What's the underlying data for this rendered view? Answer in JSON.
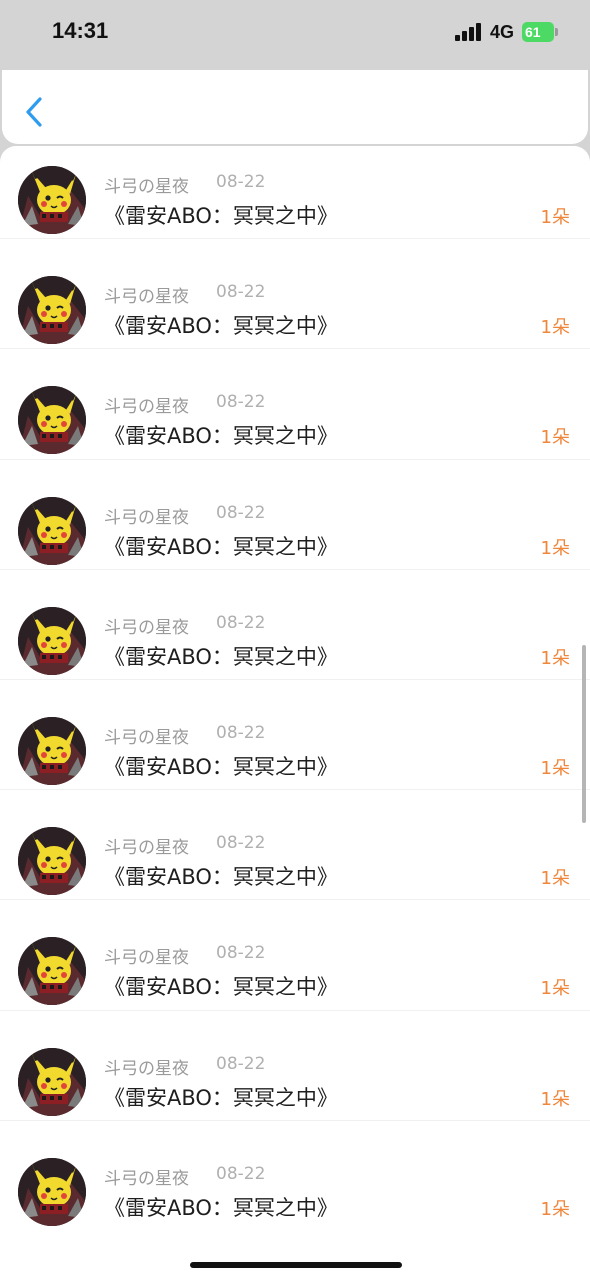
{
  "status_bar": {
    "time": "14:31",
    "network": "4G",
    "battery_level": "61",
    "signal_icon": "cellular-signal-icon",
    "battery_icon": "battery-charging-icon"
  },
  "nav": {
    "back_icon": "chevron-left-icon",
    "accent_color": "#2f9cf0"
  },
  "items": [
    {
      "author": "斗弓の星夜",
      "date": "08-22",
      "title": "《雷安ABO：冥冥之中》",
      "count": "1朵"
    },
    {
      "author": "斗弓の星夜",
      "date": "08-22",
      "title": "《雷安ABO：冥冥之中》",
      "count": "1朵"
    },
    {
      "author": "斗弓の星夜",
      "date": "08-22",
      "title": "《雷安ABO：冥冥之中》",
      "count": "1朵"
    },
    {
      "author": "斗弓の星夜",
      "date": "08-22",
      "title": "《雷安ABO：冥冥之中》",
      "count": "1朵"
    },
    {
      "author": "斗弓の星夜",
      "date": "08-22",
      "title": "《雷安ABO：冥冥之中》",
      "count": "1朵"
    },
    {
      "author": "斗弓の星夜",
      "date": "08-22",
      "title": "《雷安ABO：冥冥之中》",
      "count": "1朵"
    },
    {
      "author": "斗弓の星夜",
      "date": "08-22",
      "title": "《雷安ABO：冥冥之中》",
      "count": "1朵"
    },
    {
      "author": "斗弓の星夜",
      "date": "08-22",
      "title": "《雷安ABO：冥冥之中》",
      "count": "1朵"
    },
    {
      "author": "斗弓の星夜",
      "date": "08-22",
      "title": "《雷安ABO：冥冥之中》",
      "count": "1朵"
    },
    {
      "author": "斗弓の星夜",
      "date": "08-22",
      "title": "《雷安ABO：冥冥之中》",
      "count": "1朵"
    }
  ],
  "colors": {
    "count_color": "#f0863a",
    "author_color": "#9a9a9a",
    "title_color": "#1e1e1e"
  }
}
